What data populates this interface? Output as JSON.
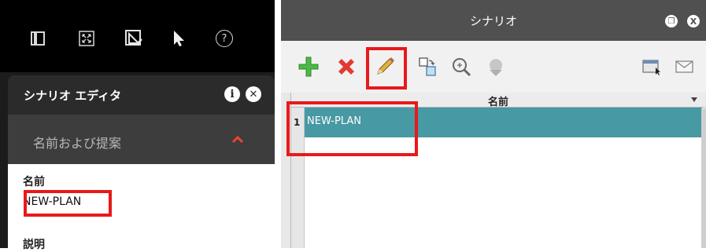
{
  "left_panel": {
    "toolbar": {
      "icons": [
        "panel-icon",
        "fit-extent-icon",
        "edit-shape-icon",
        "pointer-icon",
        "help-icon"
      ],
      "help_glyph": "?"
    },
    "editor": {
      "title": "シナリオ エディタ",
      "info_glyph": "i",
      "close_glyph": "✕"
    },
    "section": {
      "label": "名前および提案"
    },
    "form": {
      "name_label": "名前",
      "name_value": "NEW-PLAN",
      "description_label": "説明"
    }
  },
  "right_panel": {
    "title": "シナリオ",
    "float_glyph": "❐",
    "close_glyph": "X",
    "tools": [
      "add-icon",
      "delete-icon",
      "edit-pencil-icon",
      "copy-icon",
      "zoom-to-icon",
      "erase-icon",
      "window-icon",
      "mail-icon"
    ],
    "grid": {
      "column_header": "名前",
      "rows": [
        {
          "number": "1",
          "name": "NEW-PLAN"
        }
      ]
    }
  },
  "colors": {
    "highlight": "#e8191b",
    "selected_row": "#4799a3",
    "title_bar": "#505050"
  }
}
